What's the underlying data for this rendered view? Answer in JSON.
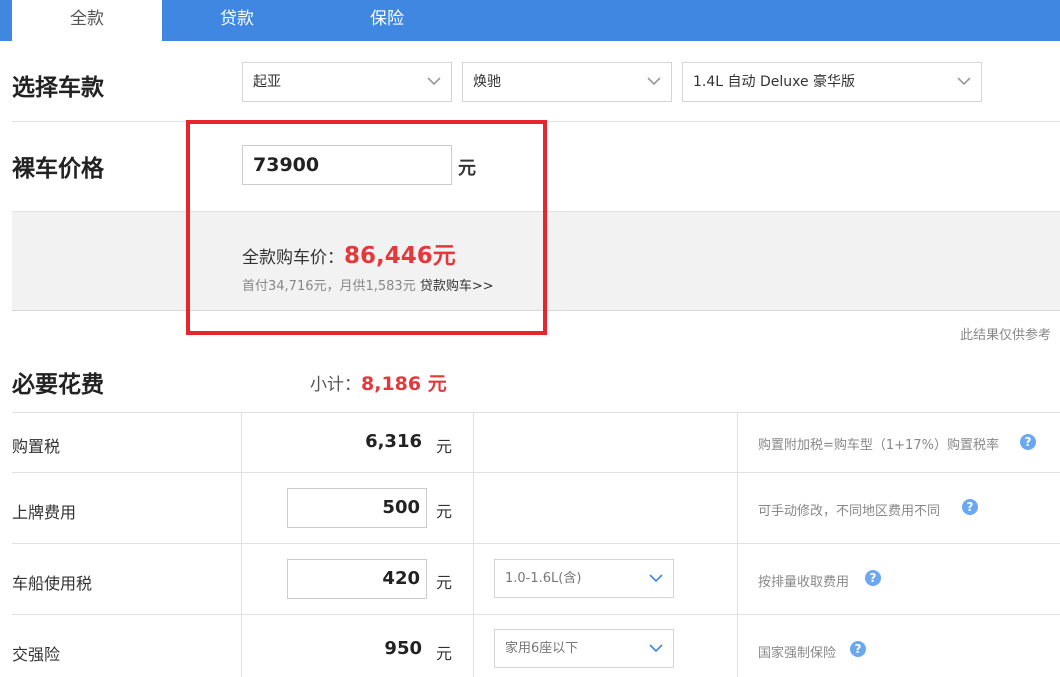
{
  "tabs": [
    {
      "label": "全款"
    },
    {
      "label": "贷款"
    },
    {
      "label": "保险"
    }
  ],
  "select_car": {
    "title": "选择车款",
    "brand": "起亚",
    "series": "焕驰",
    "model": "1.4L 自动 Deluxe 豪华版"
  },
  "bare_price": {
    "title": "裸车价格",
    "value": "73900",
    "unit": "元"
  },
  "total": {
    "label": "全款购车价：",
    "amount": "86,446元",
    "sub": "首付34,716元，月供1,583元",
    "loan_link": "贷款购车>>"
  },
  "disclaimer": "此结果仅供参考",
  "required": {
    "title": "必要花费",
    "subtotal_label": "小计：",
    "subtotal_value": "8,186 元",
    "rows": [
      {
        "label": "购置税",
        "value": "6,316",
        "unit": "元",
        "option": "",
        "note": "购置附加税=购车型（1+17%）购置税率"
      },
      {
        "label": "上牌费用",
        "value": "500",
        "unit": "元",
        "option": "",
        "note": "可手动修改，不同地区费用不同"
      },
      {
        "label": "车船使用税",
        "value": "420",
        "unit": "元",
        "option": "1.0-1.6L(含)",
        "note": "按排量收取费用"
      },
      {
        "label": "交强险",
        "value": "950",
        "unit": "元",
        "option": "家用6座以下",
        "note": "国家强制保险"
      }
    ]
  },
  "help_glyph": "?",
  "colors": {
    "tab_bar": "#3f87e0",
    "accent_red": "#e4393c",
    "frame_red": "#e6262c",
    "help_blue": "#6aa8f0"
  }
}
